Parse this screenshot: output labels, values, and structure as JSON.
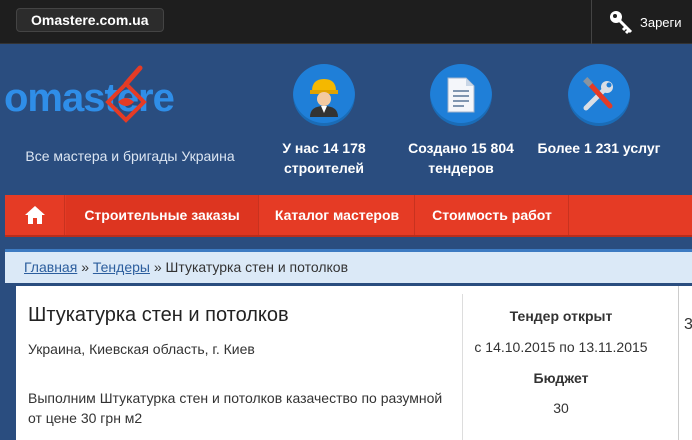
{
  "topbar": {
    "site_name": "Omastere.com.ua",
    "register_label": "Зареги"
  },
  "logo": {
    "text": "omastere"
  },
  "tagline": "Все мастера и бригады Украина",
  "stats": [
    {
      "icon": "builder-icon",
      "text": "У нас 14 178 строителей"
    },
    {
      "icon": "document-icon",
      "text": "Создано 15 804 тендеров"
    },
    {
      "icon": "tools-icon",
      "text": "Более 1 231 услуг"
    }
  ],
  "nav": {
    "home_icon": "home-icon",
    "items": [
      "Строительные заказы",
      "Каталог мастеров",
      "Стоимость работ"
    ]
  },
  "breadcrumb": {
    "home": "Главная",
    "sep": "»",
    "tenders": "Тендеры",
    "current": "Штукатурка стен и потолков"
  },
  "tender": {
    "title": "Штукатурка стен и потолков",
    "location": "Украина, Киевская область, г. Киев",
    "description": "Выполним Штукатурка стен и потолков казачество по разумной от цене 30 грн м2",
    "open_label": "Тендер открыт",
    "dates": "с 14.10.2015 по 13.11.2015",
    "budget_label": "Бюджет",
    "budget_value": "30"
  },
  "side_panel": {
    "number": "3"
  },
  "colors": {
    "header_bg": "#2a4d7f",
    "nav_bg": "#e53b25",
    "logo_blue": "#2f8ee8",
    "icon_blue": "#1f7fd8"
  }
}
